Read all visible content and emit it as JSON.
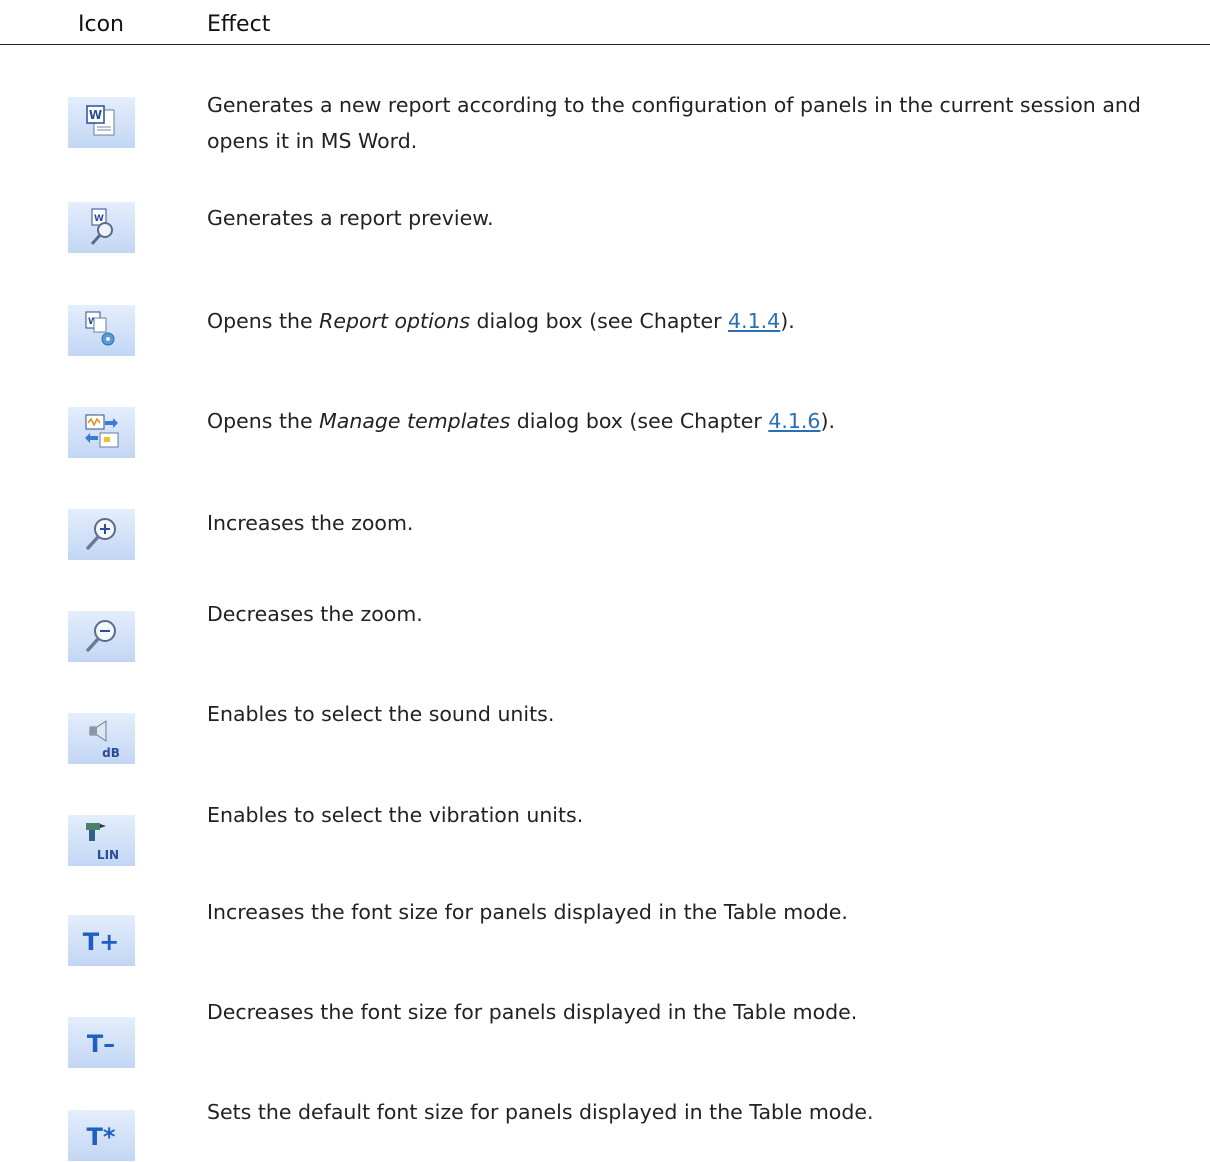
{
  "table": {
    "headers": {
      "icon": "Icon",
      "effect": "Effect"
    },
    "rows": [
      {
        "icon": "word-report-icon",
        "text": "Generates a new report according to the configuration of panels in the current session and opens it in MS Word."
      },
      {
        "icon": "report-preview-icon",
        "text": "Generates a report preview."
      },
      {
        "icon": "report-options-icon",
        "pre": "Opens the ",
        "em": "Report options",
        "mid": " dialog box (see Chapter ",
        "link": "4.1.4",
        "post": ")."
      },
      {
        "icon": "manage-templates-icon",
        "pre": "Opens the ",
        "em": "Manage templates",
        "mid": " dialog box (see Chapter ",
        "link": "4.1.6",
        "post": ")."
      },
      {
        "icon": "zoom-in-icon",
        "text": "Increases the zoom."
      },
      {
        "icon": "zoom-out-icon",
        "text": "Decreases the zoom."
      },
      {
        "icon": "sound-units-icon",
        "icon_label": "dB",
        "text": "Enables to select the sound units."
      },
      {
        "icon": "vibration-units-icon",
        "icon_label": "LIN",
        "text": "Enables to select the vibration units."
      },
      {
        "icon": "font-increase-icon",
        "icon_label": "T+",
        "text": "Increases the font size for panels displayed in the Table mode."
      },
      {
        "icon": "font-decrease-icon",
        "icon_label": "T–",
        "text": "Decreases the font size for panels displayed in the Table mode."
      },
      {
        "icon": "font-default-icon",
        "icon_label": "T*",
        "text": "Sets the default font size for panels displayed in the Table mode."
      }
    ]
  }
}
